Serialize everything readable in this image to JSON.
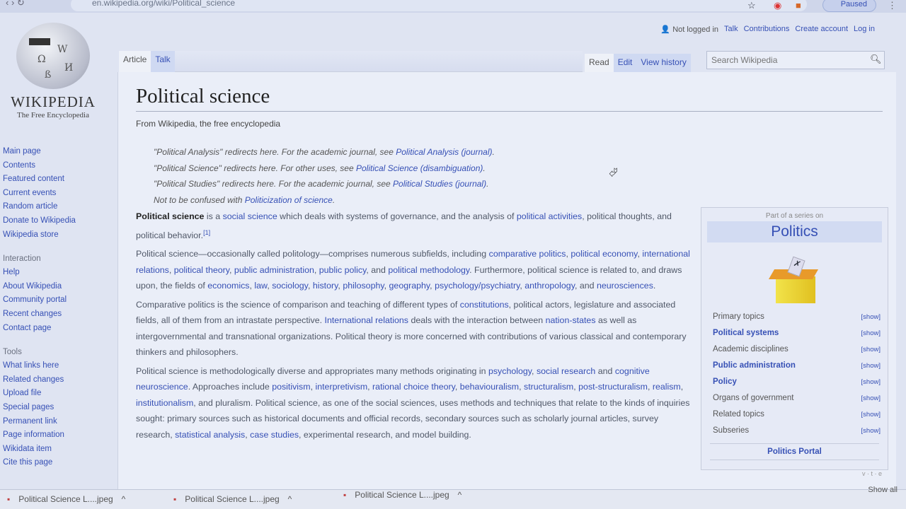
{
  "browser": {
    "url": "en.wikipedia.org/wiki/Political_science",
    "profile_status": "Paused"
  },
  "logo": {
    "wordmark": "WIKIPEDIA",
    "tagline": "The Free Encyclopedia"
  },
  "sidebar": {
    "nav": [
      "Main page",
      "Contents",
      "Featured content",
      "Current events",
      "Random article",
      "Donate to Wikipedia",
      "Wikipedia store"
    ],
    "interaction_heading": "Interaction",
    "interaction": [
      "Help",
      "About Wikipedia",
      "Community portal",
      "Recent changes",
      "Contact page"
    ],
    "tools_heading": "Tools",
    "tools": [
      "What links here",
      "Related changes",
      "Upload file",
      "Special pages",
      "Permanent link",
      "Page information",
      "Wikidata item",
      "Cite this page"
    ]
  },
  "personal": {
    "status": "Not logged in",
    "links": [
      "Talk",
      "Contributions",
      "Create account",
      "Log in"
    ]
  },
  "tabs": {
    "article": "Article",
    "talk": "Talk",
    "read": "Read",
    "edit": "Edit",
    "history": "View history"
  },
  "search": {
    "placeholder": "Search Wikipedia"
  },
  "article": {
    "title": "Political science",
    "subtitle": "From Wikipedia, the free encyclopedia",
    "hatnotes": [
      [
        [
          "\"Political Analysis\" redirects here. For the academic journal, see ",
          0
        ],
        [
          "Political Analysis (journal)",
          1
        ],
        [
          ".",
          0
        ]
      ],
      [
        [
          "\"Political Science\" redirects here. For other uses, see ",
          0
        ],
        [
          "Political Science (disambiguation)",
          1
        ],
        [
          ".",
          0
        ]
      ],
      [
        [
          "\"Political Studies\" redirects here. For the academic journal, see ",
          0
        ],
        [
          "Political Studies (journal)",
          1
        ],
        [
          ".",
          0
        ]
      ],
      [
        [
          "Not to be confused with ",
          0
        ],
        [
          "Politicization of science",
          1
        ],
        [
          ".",
          0
        ]
      ]
    ],
    "paragraphs": [
      [
        [
          "Political science",
          2
        ],
        [
          " is a ",
          0
        ],
        [
          "social science",
          1
        ],
        [
          " which deals with systems of governance, and the analysis of ",
          0
        ],
        [
          "political activities",
          1
        ],
        [
          ", political thoughts, and political behavior.",
          0
        ],
        [
          "[1]",
          3
        ]
      ],
      [
        [
          "Political science—occasionally called politology—comprises numerous subfields, including ",
          0
        ],
        [
          "comparative politics",
          1
        ],
        [
          ", ",
          0
        ],
        [
          "political economy",
          1
        ],
        [
          ", ",
          0
        ],
        [
          "international relations",
          1
        ],
        [
          ", ",
          0
        ],
        [
          "political theory",
          1
        ],
        [
          ", ",
          0
        ],
        [
          "public administration",
          1
        ],
        [
          ", ",
          0
        ],
        [
          "public policy",
          1
        ],
        [
          ", and ",
          0
        ],
        [
          "political methodology",
          1
        ],
        [
          ". Furthermore, political science is related to, and draws upon, the fields of ",
          0
        ],
        [
          "economics",
          1
        ],
        [
          ", ",
          0
        ],
        [
          "law",
          1
        ],
        [
          ", ",
          0
        ],
        [
          "sociology",
          1
        ],
        [
          ", ",
          0
        ],
        [
          "history",
          1
        ],
        [
          ", ",
          0
        ],
        [
          "philosophy",
          1
        ],
        [
          ", ",
          0
        ],
        [
          "geography",
          1
        ],
        [
          ", ",
          0
        ],
        [
          "psychology/psychiatry",
          1
        ],
        [
          ", ",
          0
        ],
        [
          "anthropology",
          1
        ],
        [
          ", and ",
          0
        ],
        [
          "neurosciences",
          1
        ],
        [
          ".",
          0
        ]
      ],
      [
        [
          "Comparative politics is the science of comparison and teaching of different types of ",
          0
        ],
        [
          "constitutions",
          1
        ],
        [
          ", political actors, legislature and associated fields, all of them from an intrastate perspective. ",
          0
        ],
        [
          "International relations",
          1
        ],
        [
          " deals with the interaction between ",
          0
        ],
        [
          "nation-states",
          1
        ],
        [
          " as well as intergovernmental and transnational organizations. Political theory is more concerned with contributions of various classical and contemporary thinkers and philosophers.",
          0
        ]
      ],
      [
        [
          "Political science is methodologically diverse and appropriates many methods originating in ",
          0
        ],
        [
          "psychology",
          1
        ],
        [
          ", ",
          0
        ],
        [
          "social research",
          1
        ],
        [
          " and ",
          0
        ],
        [
          "cognitive neuroscience",
          1
        ],
        [
          ". Approaches include ",
          0
        ],
        [
          "positivism",
          1
        ],
        [
          ", ",
          0
        ],
        [
          "interpretivism",
          1
        ],
        [
          ", ",
          0
        ],
        [
          "rational choice theory",
          1
        ],
        [
          ", ",
          0
        ],
        [
          "behaviouralism",
          1
        ],
        [
          ", ",
          0
        ],
        [
          "structuralism",
          1
        ],
        [
          ", ",
          0
        ],
        [
          "post-structuralism",
          1
        ],
        [
          ", ",
          0
        ],
        [
          "realism",
          1
        ],
        [
          ", ",
          0
        ],
        [
          "institutionalism",
          1
        ],
        [
          ", and pluralism. Political science, as one of the social sciences, uses methods and techniques that relate to the kinds of inquiries sought: primary sources such as historical documents and official records, secondary sources such as scholarly journal articles, survey research, ",
          0
        ],
        [
          "statistical analysis",
          1
        ],
        [
          ", ",
          0
        ],
        [
          "case studies",
          1
        ],
        [
          ", experimental research, and model building.",
          0
        ]
      ]
    ]
  },
  "infobox": {
    "above": "Part of a series on",
    "title": "Politics",
    "rows": [
      {
        "label": "Primary topics",
        "link": false
      },
      {
        "label": "Political systems",
        "link": true
      },
      {
        "label": "Academic disciplines",
        "link": false
      },
      {
        "label": "Public administration",
        "link": true
      },
      {
        "label": "Policy",
        "link": true
      },
      {
        "label": "Organs of government",
        "link": false
      },
      {
        "label": "Related topics",
        "link": false
      },
      {
        "label": "Subseries",
        "link": false
      }
    ],
    "show_label": "[show]",
    "portal": "Politics Portal",
    "vte": "v · t · e"
  },
  "downloads": {
    "items": [
      "Political Science L....jpeg",
      "Political Science L....jpeg",
      "Political Science L....jpeg"
    ],
    "show_all": "Show all"
  },
  "colors": {
    "link": "#3650b5",
    "background": "#dfe4f2"
  }
}
